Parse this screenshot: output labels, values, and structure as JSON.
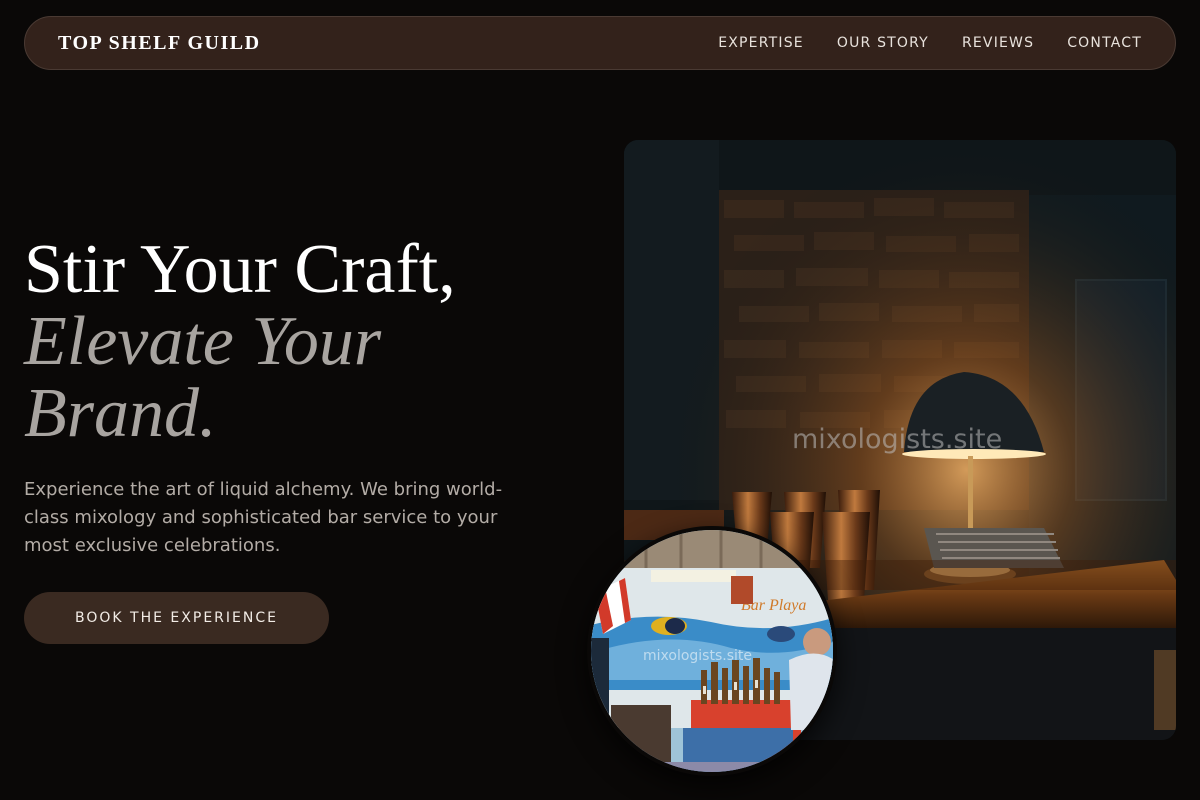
{
  "brand": {
    "name": "TOP SHELF GUILD"
  },
  "nav": {
    "items": [
      {
        "label": "EXPERTISE"
      },
      {
        "label": "OUR STORY"
      },
      {
        "label": "REVIEWS"
      },
      {
        "label": "CONTACT"
      }
    ]
  },
  "hero": {
    "title_line1": "Stir Your Craft,",
    "title_accent": "Elevate Your Brand.",
    "subtitle": "Experience the art of liquid alchemy. We bring world-class mixology and sophisticated bar service to your most exclusive celebrations.",
    "cta_label": "BOOK THE EXPERIENCE"
  },
  "images": {
    "main_watermark": "mixologists.site",
    "inset_watermark": "mixologists.site",
    "inset_sign": "Bar Playa"
  },
  "colors": {
    "background": "#0a0807",
    "nav_bg": "#33221b",
    "cta_bg": "#3a2a21",
    "accent_text": "#a8a4a0",
    "body_text": "#b3aca6"
  }
}
